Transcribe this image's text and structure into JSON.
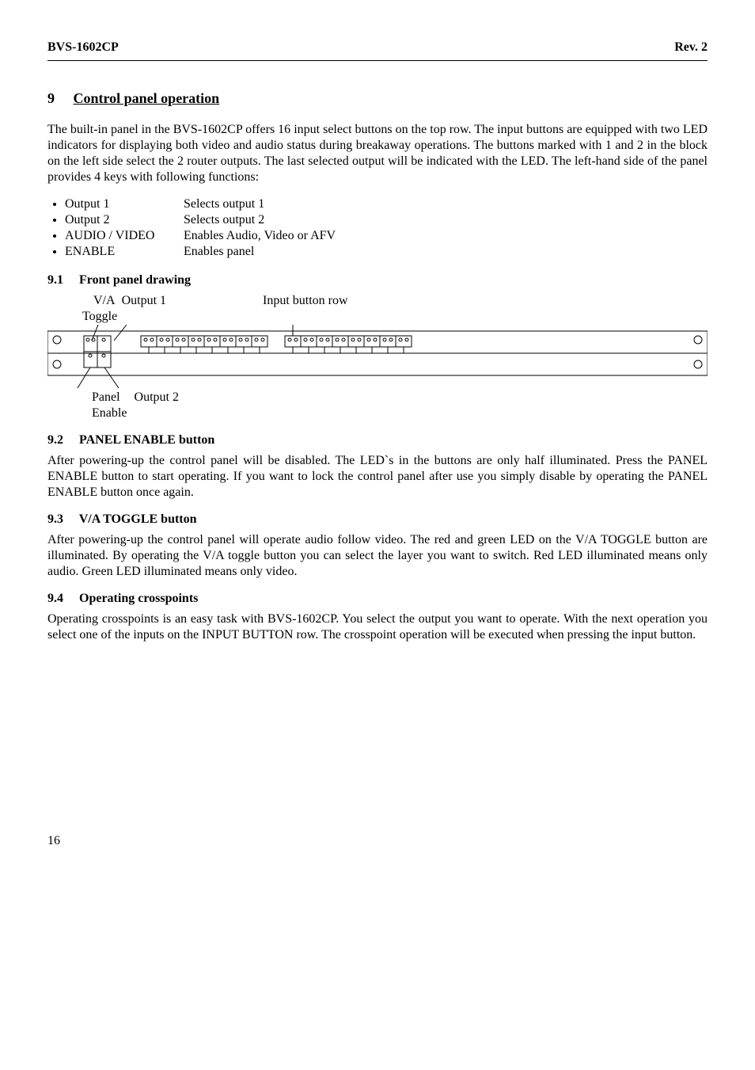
{
  "header": {
    "left": "BVS-1602CP",
    "right": "Rev. 2"
  },
  "section9": {
    "num": "9",
    "title": "Control panel operation",
    "intro": "The built-in panel in the BVS-1602CP offers 16 input select buttons on the top row. The input buttons are equipped with two LED indicators for displaying both video and audio status during breakaway operations. The buttons marked with 1 and 2 in the block on the left side select the 2 router outputs. The last selected output will be indicated with the LED. The left-hand side of the panel provides 4 keys with following functions:",
    "bullets": [
      {
        "name": "Output 1",
        "desc": "Selects output 1"
      },
      {
        "name": "Output 2",
        "desc": "Selects output 2"
      },
      {
        "name": "AUDIO / VIDEO",
        "desc": "Enables Audio, Video or AFV"
      },
      {
        "name": "ENABLE",
        "desc": "Enables panel"
      }
    ]
  },
  "section91": {
    "num": "9.1",
    "title": "Front panel drawing",
    "labels": {
      "va": "V/A",
      "out1": "Output 1",
      "toggle": "Toggle",
      "input_row": "Input button row",
      "panel": "Panel",
      "enable": "Enable",
      "out2": "Output 2"
    }
  },
  "section92": {
    "num": "9.2",
    "title": "PANEL ENABLE button",
    "body": "After powering-up the control panel will be disabled. The LED`s in the buttons are only half illuminated. Press the PANEL ENABLE button to start operating. If you want to lock the control panel after use you simply disable by operating the PANEL ENABLE button once again."
  },
  "section93": {
    "num": "9.3",
    "title": "V/A TOGGLE button",
    "body": "After powering-up the control panel will operate audio follow video. The red and green LED on the V/A TOGGLE button are illuminated. By operating the V/A toggle button you can select the layer you want to switch. Red LED illuminated means only audio. Green LED illuminated means only video."
  },
  "section94": {
    "num": "9.4",
    "title": "Operating crosspoints",
    "body": "Operating crosspoints is an easy task with BVS-1602CP. You select the output you want to operate. With the next operation you select one of the inputs on the INPUT BUTTON row. The crosspoint operation will be executed when pressing the input button."
  },
  "page": "16"
}
